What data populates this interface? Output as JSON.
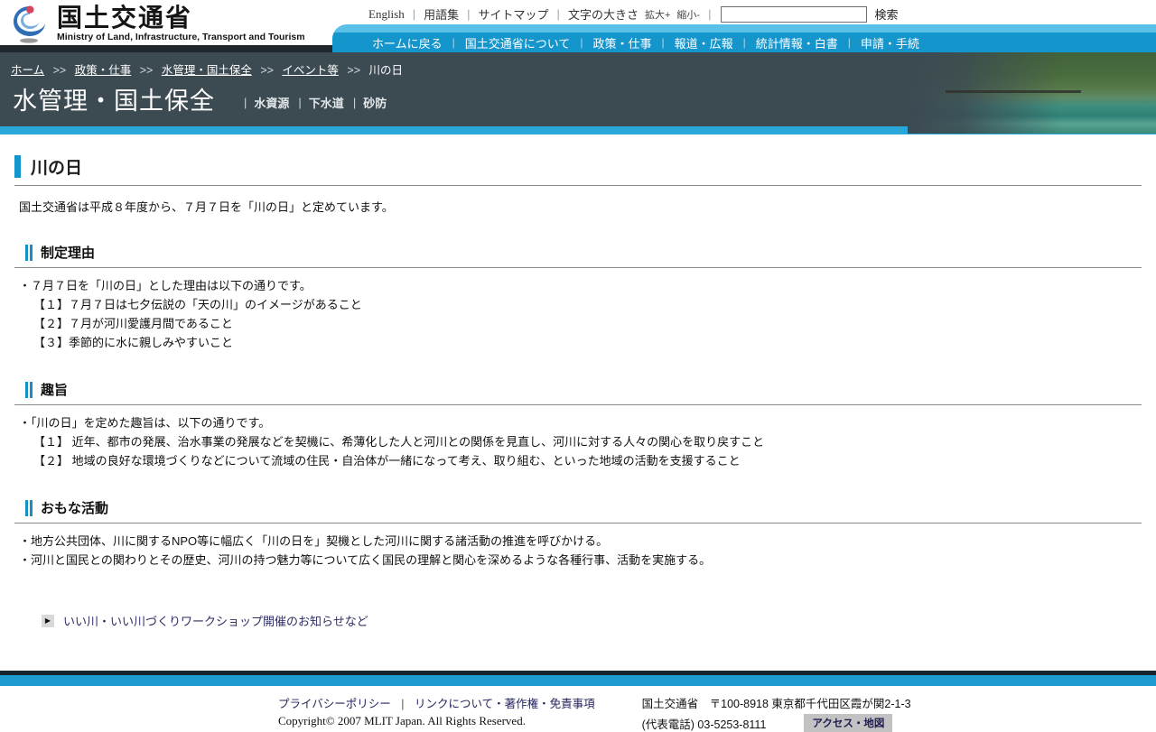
{
  "header": {
    "logo": {
      "title": "国土交通省",
      "subtitle": "Ministry of Land, Infrastructure, Transport and Tourism"
    },
    "utility": {
      "sep": "|",
      "english": "English",
      "glossary": "用語集",
      "sitemap": "サイトマップ",
      "font_size_label": "文字の大きさ",
      "enlarge": "拡大+",
      "shrink": "縮小-",
      "search_placeholder": "",
      "search_button": "検索"
    },
    "nav": {
      "sep": "|",
      "items": [
        {
          "label": "ホームに戻る"
        },
        {
          "label": "国土交通省について"
        },
        {
          "label": "政策・仕事"
        },
        {
          "label": "報道・広報"
        },
        {
          "label": "統計情報・白書"
        },
        {
          "label": "申請・手続"
        }
      ]
    }
  },
  "banner": {
    "breadcrumb": {
      "sep": ">>",
      "links": [
        {
          "label": "ホーム"
        },
        {
          "label": "政策・仕事"
        },
        {
          "label": "水管理・国土保全"
        },
        {
          "label": "イベント等"
        }
      ],
      "current": "川の日"
    },
    "title": "水管理・国土保全",
    "sub_sep": "|",
    "sub_links": [
      {
        "label": "水資源"
      },
      {
        "label": "下水道"
      },
      {
        "label": "砂防"
      }
    ]
  },
  "main": {
    "page_title": "川の日",
    "intro": "国土交通省は平成８年度から、７月７日を「川の日」と定めています。",
    "sections": [
      {
        "heading": "制定理由",
        "lead": "・７月７日を「川の日」とした理由は以下の通りです。",
        "items": [
          "【１】７月７日は七夕伝説の「天の川」のイメージがあること",
          "【２】７月が河川愛護月間であること",
          "【３】季節的に水に親しみやすいこと"
        ]
      },
      {
        "heading": "趣旨",
        "lead": "・「川の日」を定めた趣旨は、以下の通りです。",
        "items": [
          "【１】 近年、都市の発展、治水事業の発展などを契機に、希薄化した人と河川との関係を見直し、河川に対する人々の関心を取り戻すこと",
          "【２】 地域の良好な環境づくりなどについて流域の住民・自治体が一緒になって考え、取り組む、といった地域の活動を支援すること"
        ]
      },
      {
        "heading": "おもな活動",
        "bullets": [
          "・地方公共団体、川に関するNPO等に幅広く「川の日を」契機とした河川に関する諸活動の推進を呼びかける。",
          "・河川と国民との関わりとその歴史、河川の持つ魅力等について広く国民の理解と関心を深めるような各種行事、活動を実施する。"
        ]
      }
    ],
    "related_link": "いい川・いい川づくりワークショップ開催のお知らせなど"
  },
  "footer": {
    "sep": "|",
    "privacy": "プライバシーポリシー",
    "terms": "リンクについて・著作権・免責事項",
    "copyright": "Copyright© 2007 MLIT Japan. All Rights Reserved.",
    "org_address": "国土交通省　〒100-8918 東京都千代田区霞が関2-1-3",
    "phone": "(代表電話) 03-5253-8111",
    "access_button": "アクセス・地図"
  },
  "colors": {
    "nav_blue": "#1495cc",
    "nav_light_blue": "#5bc0e8",
    "banner_slate": "#3c4a52",
    "strip_cyan": "#29a6da",
    "footer_cyan": "#1e9cd2",
    "heading_accent": "#1590c4"
  }
}
